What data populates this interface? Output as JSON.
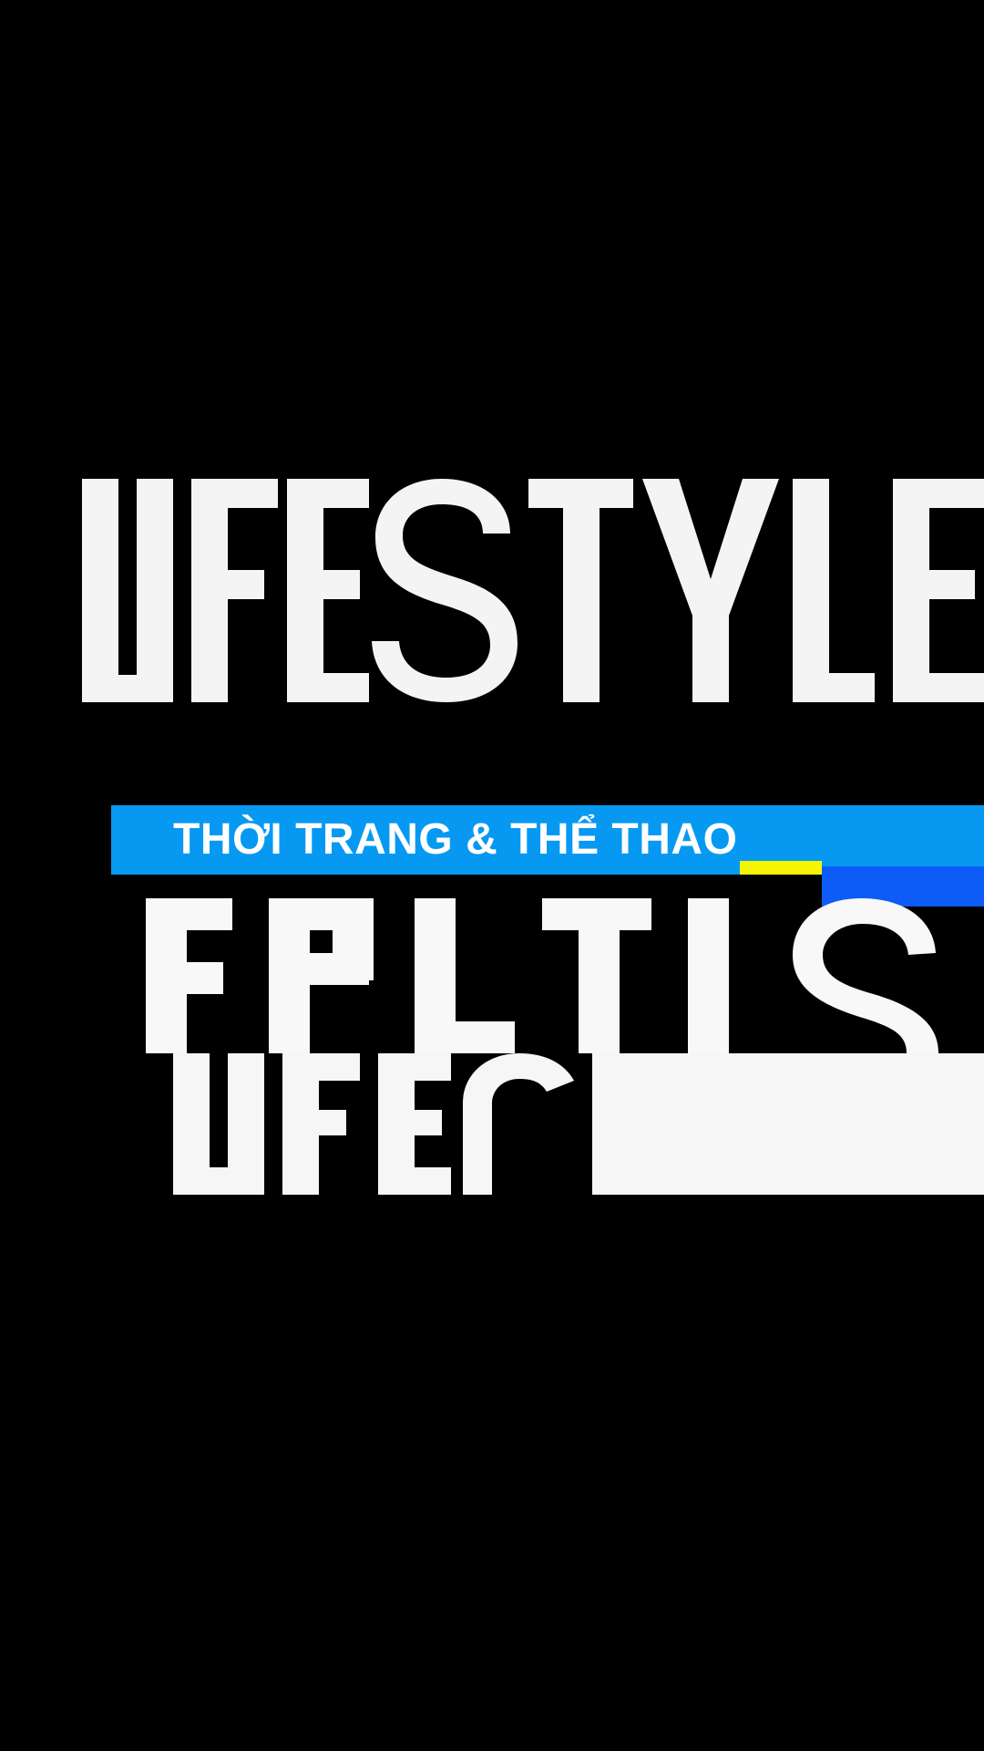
{
  "colors": {
    "background": "#000000",
    "wordmark": "#f4f4f4",
    "banner_blue": "#0799f2",
    "accent_yellow": "#f5f500",
    "accent_blue": "#0d5cf5",
    "banner_text": "#ffffff"
  },
  "wordmark": {
    "main_text": "LIFESTYLE"
  },
  "banner": {
    "label": "THỜI TRANG & THỂ THAO"
  }
}
